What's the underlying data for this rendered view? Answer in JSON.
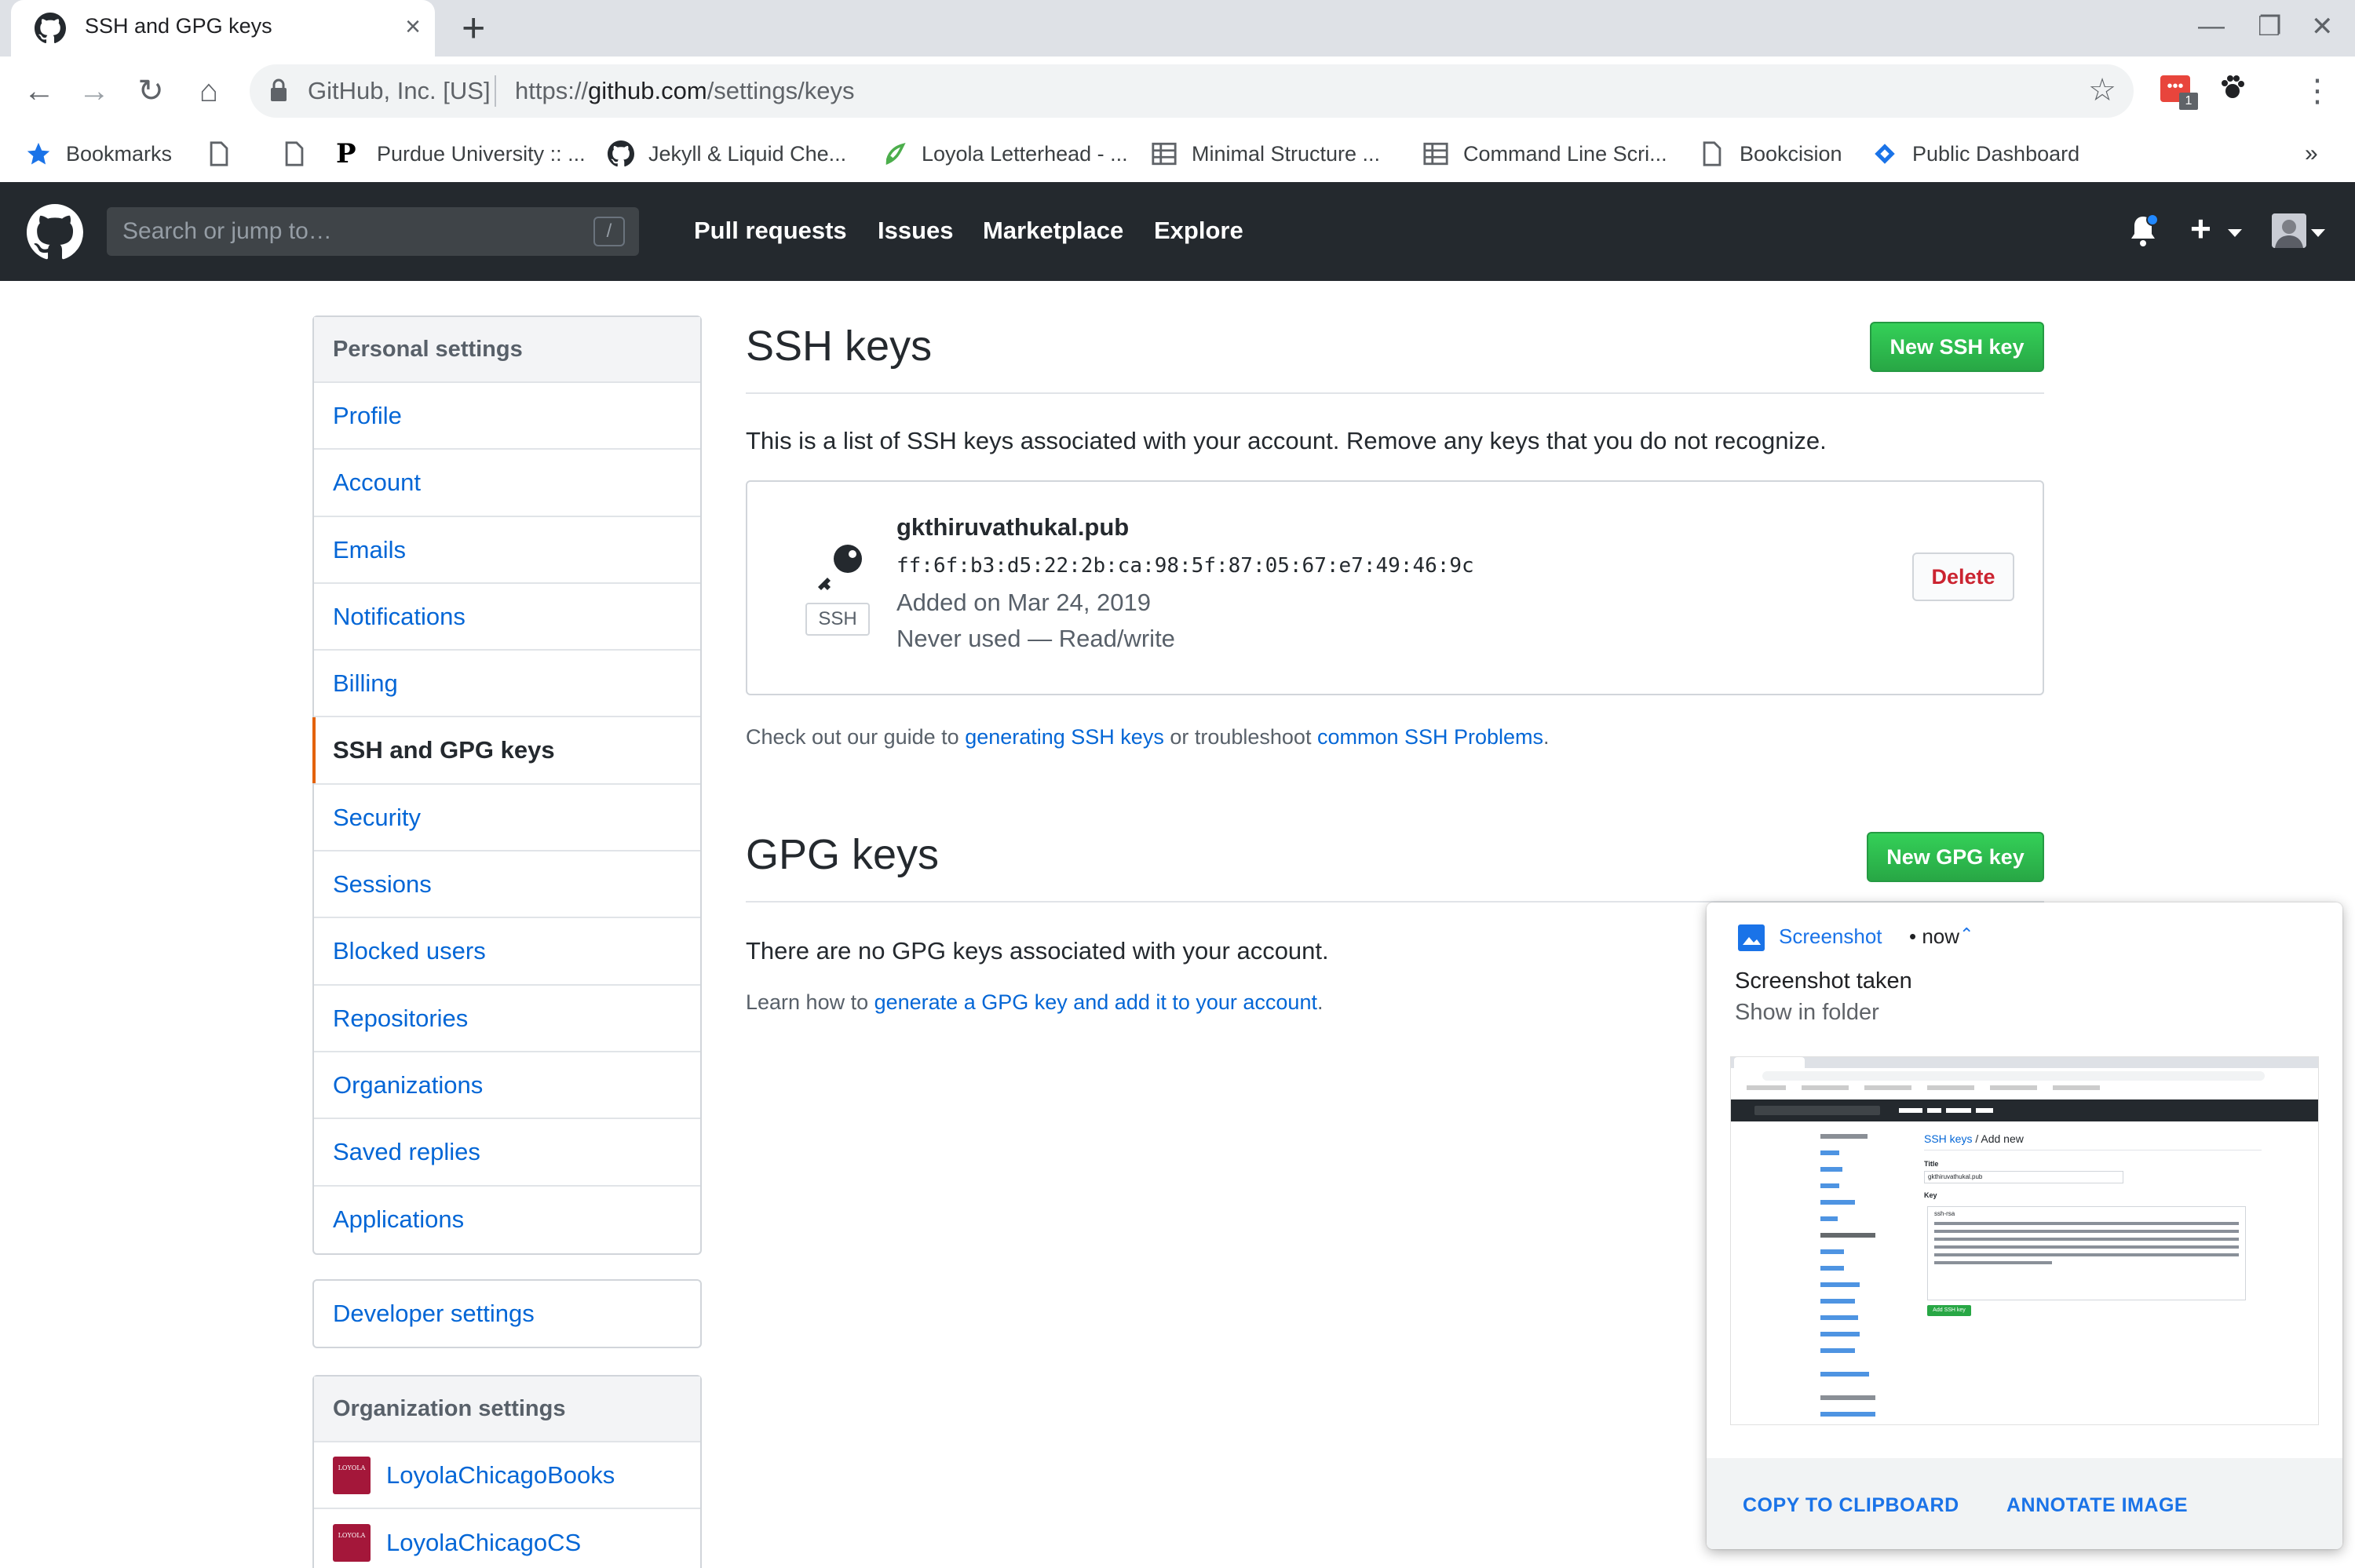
{
  "browser": {
    "tab_title": "SSH and GPG keys",
    "tab_close": "×",
    "new_tab": "+",
    "window_controls": {
      "minimize": "—",
      "restore": "❐",
      "close": "✕"
    },
    "nav": {
      "back": "←",
      "forward": "→",
      "reload": "↻",
      "home": "⌂"
    },
    "site_identity": "GitHub, Inc. [US]",
    "url_prefix": "https://",
    "url_host": "github.com",
    "url_path": "/settings/keys",
    "bookmark_star": "☆",
    "extension_badge": "1",
    "menu_dots": "⋮",
    "bookmarks": [
      {
        "label": "Bookmarks",
        "icon": "star-icon"
      },
      {
        "label": "",
        "icon": "page-icon"
      },
      {
        "label": "",
        "icon": "page-icon"
      },
      {
        "label": "Purdue University :: ...",
        "icon": "purdue-icon"
      },
      {
        "label": "Jekyll & Liquid Che...",
        "icon": "github-icon"
      },
      {
        "label": "Loyola Letterhead - ...",
        "icon": "overleaf-icon"
      },
      {
        "label": "Minimal Structure ...",
        "icon": "sheet-icon"
      },
      {
        "label": "Command Line Scri...",
        "icon": "sheet-icon"
      },
      {
        "label": "Bookcision",
        "icon": "page-icon"
      },
      {
        "label": "Public Dashboard",
        "icon": "dashboard-icon"
      }
    ],
    "bookmarks_overflow": "»"
  },
  "github": {
    "search_placeholder": "Search or jump to…",
    "search_shortcut": "/",
    "nav": [
      "Pull requests",
      "Issues",
      "Marketplace",
      "Explore"
    ],
    "plus": "+"
  },
  "sidebar": {
    "personal_heading": "Personal settings",
    "items": [
      "Profile",
      "Account",
      "Emails",
      "Notifications",
      "Billing",
      "SSH and GPG keys",
      "Security",
      "Sessions",
      "Blocked users",
      "Repositories",
      "Organizations",
      "Saved replies",
      "Applications"
    ],
    "selected_index": 5,
    "developer_settings": "Developer settings",
    "org_heading": "Organization settings",
    "orgs": [
      "LoyolaChicagoBooks",
      "LoyolaChicagoCS"
    ],
    "org_logo_text": "LOYOLA"
  },
  "ssh": {
    "heading": "SSH keys",
    "new_button": "New SSH key",
    "intro": "This is a list of SSH keys associated with your account. Remove any keys that you do not recognize.",
    "key": {
      "label": "SSH",
      "title": "gkthiruvathukal.pub",
      "fingerprint": "ff:6f:b3:d5:22:2b:ca:98:5f:87:05:67:e7:49:46:9c",
      "added": "Added on Mar 24, 2019",
      "usage": "Never used — Read/write",
      "delete": "Delete"
    },
    "guide_prefix": "Check out our guide to ",
    "guide_link1": "generating SSH keys",
    "guide_middle": " or troubleshoot ",
    "guide_link2": "common SSH Problems",
    "guide_suffix": "."
  },
  "gpg": {
    "heading": "GPG keys",
    "new_button": "New GPG key",
    "empty": "There are no GPG keys associated with your account.",
    "learn_prefix": "Learn how to ",
    "learn_link": "generate a GPG key and add it to your account",
    "learn_suffix": "."
  },
  "notification": {
    "app": "Screenshot",
    "time": "• now",
    "chevron": "⌃",
    "title": "Screenshot taken",
    "subtitle": "Show in folder",
    "action1": "COPY TO CLIPBOARD",
    "action2": "ANNOTATE IMAGE",
    "preview": {
      "breadcrumb_link": "SSH keys",
      "breadcrumb_rest": " / Add new",
      "title_label": "Title",
      "title_value": "gkthiruvathukal.pub",
      "key_label": "Key",
      "key_value": "ssh-rsa",
      "button": "Add SSH key"
    }
  }
}
